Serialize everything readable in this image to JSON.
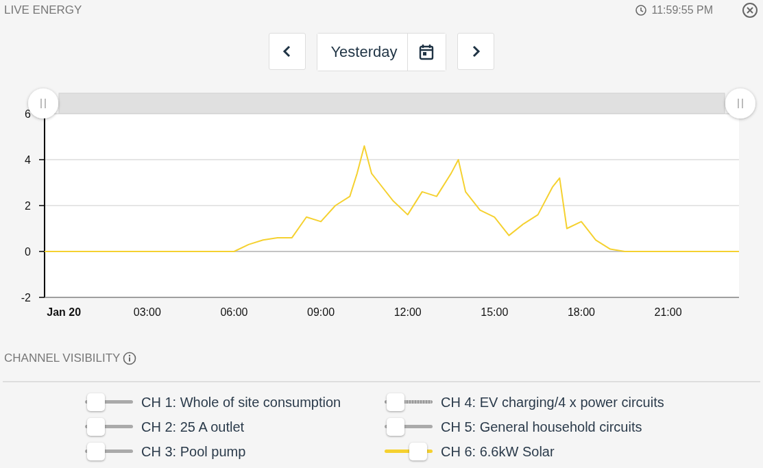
{
  "header": {
    "title": "LIVE ENERGY",
    "time": "11:59:55 PM"
  },
  "date_nav": {
    "label": "Yesterday"
  },
  "chart_data": {
    "type": "line",
    "xlim": [
      -0.55,
      23.45
    ],
    "ylim": [
      -2,
      6
    ],
    "yticks": [
      -2,
      0,
      2,
      4,
      6
    ],
    "xticks": [
      {
        "value": 0,
        "label": "Jan 20"
      },
      {
        "value": 3,
        "label": "03:00"
      },
      {
        "value": 6,
        "label": "06:00"
      },
      {
        "value": 9,
        "label": "09:00"
      },
      {
        "value": 12,
        "label": "12:00"
      },
      {
        "value": 15,
        "label": "15:00"
      },
      {
        "value": 18,
        "label": "18:00"
      },
      {
        "value": 21,
        "label": "21:00"
      }
    ],
    "x": [
      -0.55,
      0,
      1,
      2,
      3,
      4,
      5,
      6,
      6.5,
      7,
      7.5,
      8,
      8.5,
      9,
      9.5,
      10,
      10.25,
      10.5,
      10.75,
      11,
      11.5,
      12,
      12.5,
      13,
      13.5,
      13.75,
      14,
      14.5,
      15,
      15.5,
      16,
      16.5,
      17,
      17.25,
      17.5,
      18,
      18.5,
      19,
      19.5,
      20,
      21,
      22,
      23,
      23.45
    ],
    "series": [
      {
        "color": "#f5d130",
        "values": [
          0,
          0,
          0,
          0,
          0,
          0,
          0,
          0,
          0.3,
          0.5,
          0.6,
          0.6,
          1.5,
          1.3,
          2.0,
          2.4,
          3.4,
          4.6,
          3.4,
          3.0,
          2.2,
          1.6,
          2.6,
          2.4,
          3.4,
          4.0,
          2.6,
          1.8,
          1.5,
          0.7,
          1.2,
          1.6,
          2.8,
          3.2,
          1.0,
          1.3,
          0.5,
          0.1,
          0,
          0,
          0,
          0,
          0,
          0
        ]
      }
    ]
  },
  "channels_title": "CHANNEL VISIBILITY",
  "channels": [
    {
      "name": "CH 1: Whole of site consumption",
      "on": false
    },
    {
      "name": "CH 4: EV charging/4 x power circuits",
      "on": false
    },
    {
      "name": "CH 2: 25 A outlet",
      "on": false
    },
    {
      "name": "CH 5: General household circuits",
      "on": false
    },
    {
      "name": "CH 3: Pool pump",
      "on": false
    },
    {
      "name": "CH 6: 6.6kW Solar",
      "on": true
    }
  ]
}
